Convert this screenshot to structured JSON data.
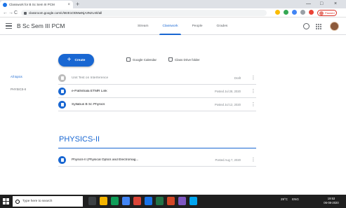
{
  "browser": {
    "tab_title": "Classwork for B Sc Sem III PCM",
    "new_tab": "+",
    "window_controls": {
      "minimize": "—",
      "maximize": "□",
      "close": "×"
    },
    "nav": {
      "back": "←",
      "forward": "→",
      "reload": "C"
    },
    "url": "classroom.google.com/c/MzE1ODMwNjA3NzU4/t/all",
    "profile_label": "Paused"
  },
  "header": {
    "course_title": "B Sc Sem III PCM",
    "tabs": [
      {
        "label": "Stream",
        "active": false
      },
      {
        "label": "Classwork",
        "active": true
      },
      {
        "label": "People",
        "active": false
      },
      {
        "label": "Grades",
        "active": false
      }
    ]
  },
  "toolbar": {
    "create_label": "Create",
    "calendar_label": "Google Calendar",
    "drive_label": "Class Drive folder"
  },
  "topics": [
    {
      "label": "All topics",
      "active": true
    },
    {
      "label": "PHYSICS-II",
      "active": false
    }
  ],
  "items": [
    {
      "name": "Unit Test on Interference",
      "date": "Draft",
      "style": "grey"
    },
    {
      "name": "e-Pathshala ETMR Link",
      "date": "Posted Jul 28, 2020",
      "style": "blue"
    },
    {
      "name": "Syllabus B Sc Physics",
      "date": "Posted Jul 12, 2020",
      "style": "blue"
    }
  ],
  "section": {
    "title": "PHYSICS-II",
    "items": [
      {
        "name": "Physics-II (Physical Optics and Electromag...",
        "date": "Posted Aug 7, 2020",
        "style": "blue"
      }
    ]
  },
  "taskbar": {
    "search_placeholder": "Type here to search",
    "tray_weather": "29°C",
    "tray_lang": "ENG",
    "time": "19:53",
    "date": "06-08-2020"
  },
  "colors": {
    "accent": "#1967d2",
    "header_border": "#dadce0",
    "taskbar": "#1f1f1f"
  }
}
